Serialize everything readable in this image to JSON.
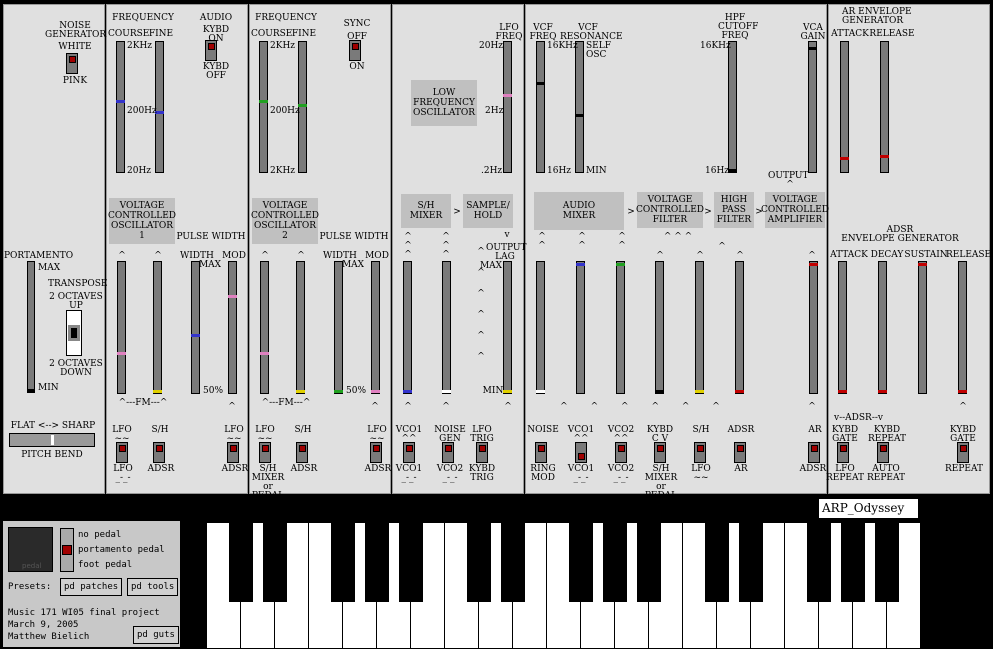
{
  "title": "ARP_Odyssey",
  "osc1": {
    "noise_generator": "NOISE\nGENERATOR",
    "white": "WHITE",
    "pink": "PINK",
    "frequency": "FREQUENCY",
    "course": "COURSE",
    "fine": "FINE",
    "audio": "AUDIO",
    "kybd_on": "KYBD\nON",
    "kybd_off": "KYBD\nOFF",
    "f_2k": "2KHz",
    "f_200": "200Hz",
    "f_20": "20Hz",
    "vco": "VOLTAGE\nCONTROLLED\nOSCILLATOR\n1",
    "pulse_width": "PULSE WIDTH",
    "width": "WIDTH",
    "max": "MAX",
    "mod": "MOD",
    "fifty": "50%",
    "fm": "^---FM---^",
    "lfo": "LFO\n~~",
    "sh": "S/H",
    "lfo2": "LFO\n~~",
    "lfo_b": "LFO\n_-_-",
    "adsr": "ADSR",
    "adsr2": "ADSR"
  },
  "osc2": {
    "frequency": "FREQUENCY",
    "course": "COURSE",
    "fine": "FINE",
    "sync": "SYNC",
    "off": "OFF",
    "on": "ON",
    "f_2k": "2KHz",
    "f_200": "200Hz",
    "f_2kb": "2KHz",
    "vco": "VOLTAGE\nCONTROLLED\nOSCILLATOR\n2",
    "pulse_width": "PULSE WIDTH",
    "width": "WIDTH",
    "max": "MAX",
    "mod": "MOD",
    "fifty": "50%",
    "fm": "^---FM---^",
    "lfo": "LFO\n~~",
    "sh": "S/H",
    "lfo2": "LFO\n~~",
    "sh_mixer": "S/H\nMIXER\nor\nPEDAL",
    "adsr": "ADSR",
    "adsr2": "ADSR"
  },
  "left": {
    "portamento": "PORTAMENTO",
    "max": "MAX",
    "min": "MIN",
    "transpose": "TRANSPOSE",
    "up": "2 OCTAVES\nUP",
    "down": "2 OCTAVES\nDOWN",
    "flat_sharp": "FLAT <--> SHARP",
    "pitch_bend": "PITCH BEND"
  },
  "lfo": {
    "freq": "LFO\nFREQ",
    "f20": "20Hz",
    "f2": "2Hz",
    "f02": ".2Hz",
    "box": "LOW\nFREQUENCY\nOSCILLATOR",
    "sh_mixer": "S/H\nMIXER",
    "sample_hold": "SAMPLE/\nHOLD",
    "output_lag": "OUTPUT\nLAG",
    "max": "MAX",
    "min": "MIN",
    "vco1": "VCO1\n^^",
    "noise_gen": "NOISE\nGEN",
    "lfo_trig": "LFO\nTRIG",
    "vco1b": "VCO1\n_-_-",
    "vco2": "VCO2\n_-_-",
    "kybd_trig": "KYBD\nTRIG"
  },
  "filter": {
    "vcf_freq": "VCF\nFREQ",
    "vcf_res": "VCF\nRESONANCE",
    "self_osc": "SELF\nOSC",
    "f16k": "16KHz",
    "f16": "16Hz",
    "min": "MIN",
    "hpf": "HPF\nCUTOFF\nFREQ",
    "h16k": "16KHz",
    "h16": "16Hz",
    "vca_gain": "VCA\nGAIN",
    "output": "OUTPUT",
    "audio_mixer": "AUDIO\nMIXER",
    "vcf": "VOLTAGE\nCONTROLLED\nFILTER",
    "hpf_box": "HIGH\nPASS\nFILTER",
    "vca": "VOLTAGE\nCONTROLLED\nAMPLIFIER",
    "noise": "NOISE",
    "vco1": "VCO1\n^^",
    "vco2": "VCO2\n^^",
    "kybd": "KYBD\nC V",
    "sh": "S/H",
    "adsr": "ADSR",
    "ar": "AR",
    "ring_mod": "RING\nMOD",
    "vco1b": "VCO1\n_-_-",
    "vco2b": "VCO2\n_-_-",
    "sh_mixer": "S/H\nMIXER\nor\nPEDAL",
    "lfo": "LFO\n~~",
    "ar2": "AR",
    "adsr2": "ADSR"
  },
  "env": {
    "ar_title": "AR ENVELOPE\nGENERATOR",
    "attack": "ATTACK",
    "release": "RELEASE",
    "adsr_title": "ADSR\nENVELOPE GENERATOR",
    "attack2": "ATTACK",
    "decay": "DECAY",
    "sustain": "SUSTAIN",
    "release2": "RELEASE",
    "adsr_line": "v--ADSR--v",
    "kybd_gate": "KYBD\nGATE",
    "kybd_repeat": "KYBD\nREPEAT",
    "kybd_gate2": "KYBD\nGATE",
    "lfo_repeat": "LFO\nREPEAT",
    "auto_repeat": "AUTO\nREPEAT",
    "repeat": "REPEAT"
  },
  "bottom": {
    "pedal": "pedal",
    "no_pedal": "no pedal",
    "portamento_pedal": "portamento pedal",
    "foot_pedal": "foot pedal",
    "presets": "Presets:",
    "pd_patches": "pd patches",
    "pd_tools": "pd tools",
    "credit1": "Music 171 WI05 final project",
    "credit2": "March 9, 2005",
    "credit3": "Matthew Bielich",
    "pd_guts": "pd guts"
  },
  "colors": {
    "knob_blue": "#3333cc",
    "knob_pink": "#e080c0",
    "knob_green": "#20a020",
    "knob_yellow": "#e0d000",
    "knob_red": "#c00000",
    "knob_black": "#000000",
    "knob_white": "#ffffff",
    "toggle_red": "#a00000"
  }
}
